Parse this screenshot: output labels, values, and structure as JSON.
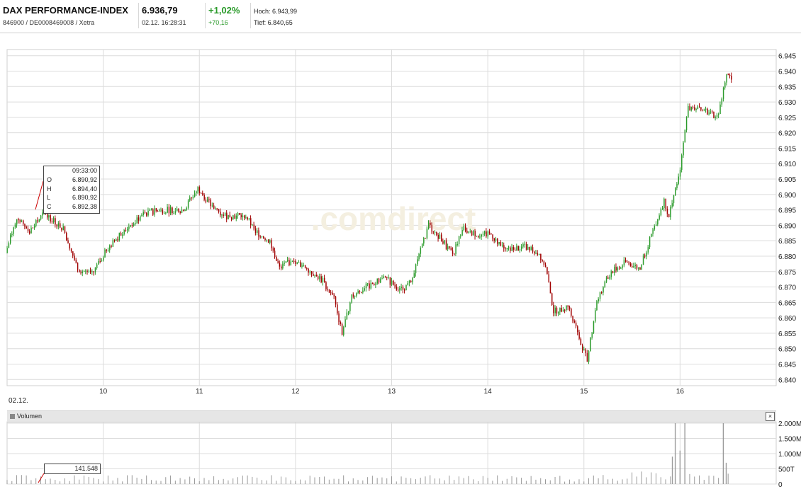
{
  "header": {
    "name": "DAX PERFORMANCE-INDEX",
    "ids": "846900 / DE0008469008 / Xetra",
    "price": "6.936,79",
    "timestamp": "02.12. 16:28:31",
    "change_pct": "+1,02%",
    "change_abs": "+70,16",
    "high": "Hoch: 6.943,99",
    "low": "Tief: 6.840,65"
  },
  "watermark": ".comdirect",
  "price_axis": {
    "ticks": [
      "6.945",
      "6.940",
      "6.935",
      "6.930",
      "6.925",
      "6.920",
      "6.915",
      "6.910",
      "6.905",
      "6.900",
      "6.895",
      "6.890",
      "6.885",
      "6.880",
      "6.875",
      "6.870",
      "6.865",
      "6.860",
      "6.855",
      "6.850",
      "6.845",
      "6.840"
    ]
  },
  "time_axis": {
    "date_label": "02.12.",
    "ticks": [
      "10",
      "11",
      "12",
      "13",
      "14",
      "15",
      "16"
    ]
  },
  "tooltip": {
    "time": "09:33:00",
    "rows": [
      {
        "k": "O",
        "v": "6.890,92"
      },
      {
        "k": "H",
        "v": "6.894,40"
      },
      {
        "k": "L",
        "v": "6.890,92"
      },
      {
        "k": "C",
        "v": "6.892,38"
      }
    ]
  },
  "volume": {
    "label": "Volumen",
    "close": "×",
    "tooltip_value": "141.548",
    "ticks": [
      "2.000M",
      "1.500M",
      "1.000M",
      "500T",
      "0"
    ]
  },
  "colors": {
    "up": "#2a9a2a",
    "down": "#a00000",
    "grid": "#dcdcdc",
    "volume": "#999999"
  },
  "chart_data": {
    "type": "candlestick",
    "x_unit": "hour",
    "y_range": [
      6840,
      6945
    ],
    "volume_range": [
      0,
      2000000
    ],
    "price_path": [
      [
        9.0,
        6881
      ],
      [
        9.12,
        6893
      ],
      [
        9.25,
        6888
      ],
      [
        9.4,
        6894
      ],
      [
        9.6,
        6889
      ],
      [
        9.75,
        6876
      ],
      [
        9.9,
        6874
      ],
      [
        10.05,
        6882
      ],
      [
        10.25,
        6889
      ],
      [
        10.45,
        6894
      ],
      [
        10.65,
        6895
      ],
      [
        10.85,
        6895
      ],
      [
        11.0,
        6902
      ],
      [
        11.15,
        6896
      ],
      [
        11.3,
        6893
      ],
      [
        11.5,
        6893
      ],
      [
        11.6,
        6888
      ],
      [
        11.75,
        6885
      ],
      [
        11.85,
        6876
      ],
      [
        11.95,
        6878
      ],
      [
        12.1,
        6877
      ],
      [
        12.3,
        6872
      ],
      [
        12.42,
        6866
      ],
      [
        12.5,
        6855
      ],
      [
        12.6,
        6867
      ],
      [
        12.75,
        6870
      ],
      [
        12.95,
        6873
      ],
      [
        13.1,
        6869
      ],
      [
        13.2,
        6871
      ],
      [
        13.3,
        6880
      ],
      [
        13.4,
        6890
      ],
      [
        13.55,
        6885
      ],
      [
        13.65,
        6880
      ],
      [
        13.75,
        6889
      ],
      [
        13.9,
        6887
      ],
      [
        14.05,
        6887
      ],
      [
        14.2,
        6882
      ],
      [
        14.4,
        6883
      ],
      [
        14.55,
        6881
      ],
      [
        14.62,
        6876
      ],
      [
        14.7,
        6862
      ],
      [
        14.85,
        6864
      ],
      [
        14.95,
        6855
      ],
      [
        15.05,
        6846
      ],
      [
        15.15,
        6866
      ],
      [
        15.3,
        6875
      ],
      [
        15.45,
        6878
      ],
      [
        15.6,
        6876
      ],
      [
        15.75,
        6890
      ],
      [
        15.85,
        6898
      ],
      [
        15.9,
        6893
      ],
      [
        16.0,
        6905
      ],
      [
        16.1,
        6928
      ],
      [
        16.3,
        6927
      ],
      [
        16.4,
        6925
      ],
      [
        16.5,
        6938
      ],
      [
        16.55,
        6938
      ]
    ],
    "volume_spikes": [
      {
        "x": 15.95,
        "value": 2000000
      },
      {
        "x": 16.05,
        "value": 2000000
      },
      {
        "x": 16.45,
        "value": 2000000
      },
      {
        "x": 15.92,
        "value": 900000
      },
      {
        "x": 16.0,
        "value": 1100000
      },
      {
        "x": 16.48,
        "value": 700000
      }
    ]
  }
}
